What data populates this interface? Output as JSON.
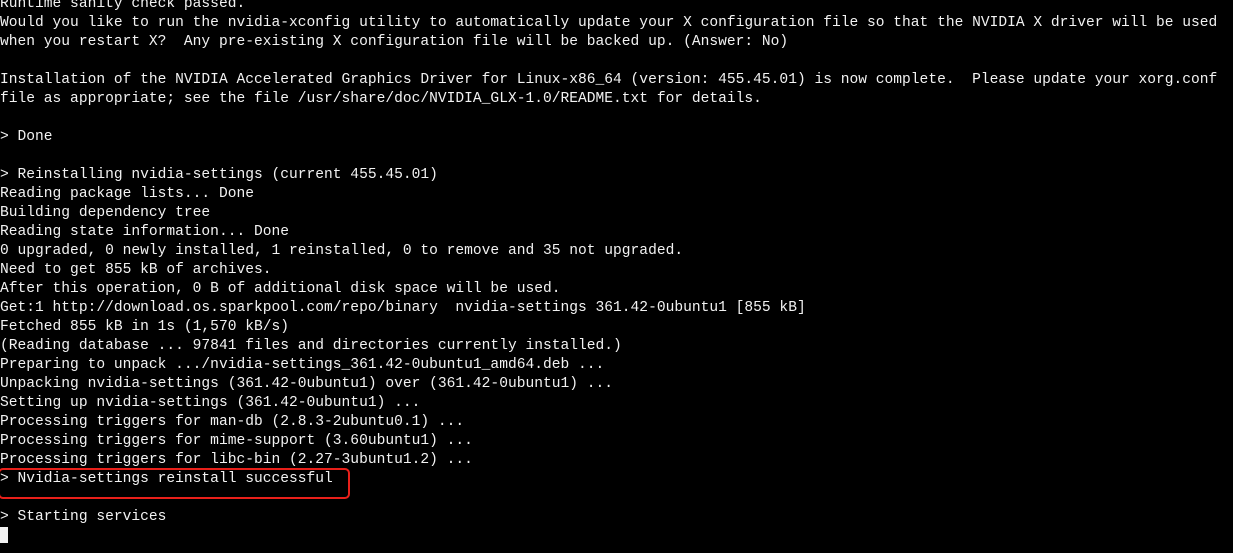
{
  "terminal": {
    "lines": [
      "Runtime sanity check passed.",
      "Would you like to run the nvidia-xconfig utility to automatically update your X configuration file so that the NVIDIA X driver will be used",
      "when you restart X?  Any pre-existing X configuration file will be backed up. (Answer: No)",
      "",
      "Installation of the NVIDIA Accelerated Graphics Driver for Linux-x86_64 (version: 455.45.01) is now complete.  Please update your xorg.conf",
      "file as appropriate; see the file /usr/share/doc/NVIDIA_GLX-1.0/README.txt for details.",
      "",
      "> Done",
      "",
      "> Reinstalling nvidia-settings (current 455.45.01)",
      "Reading package lists... Done",
      "Building dependency tree",
      "Reading state information... Done",
      "0 upgraded, 0 newly installed, 1 reinstalled, 0 to remove and 35 not upgraded.",
      "Need to get 855 kB of archives.",
      "After this operation, 0 B of additional disk space will be used.",
      "Get:1 http://download.os.sparkpool.com/repo/binary  nvidia-settings 361.42-0ubuntu1 [855 kB]",
      "Fetched 855 kB in 1s (1,570 kB/s)",
      "(Reading database ... 97841 files and directories currently installed.)",
      "Preparing to unpack .../nvidia-settings_361.42-0ubuntu1_amd64.deb ...",
      "Unpacking nvidia-settings (361.42-0ubuntu1) over (361.42-0ubuntu1) ...",
      "Setting up nvidia-settings (361.42-0ubuntu1) ...",
      "Processing triggers for man-db (2.8.3-2ubuntu0.1) ...",
      "Processing triggers for mime-support (3.60ubuntu1) ...",
      "Processing triggers for libc-bin (2.27-3ubuntu1.2) ...",
      "> Nvidia-settings reinstall successful",
      "",
      "> Starting services"
    ],
    "highlight_color": "#e8201a"
  }
}
